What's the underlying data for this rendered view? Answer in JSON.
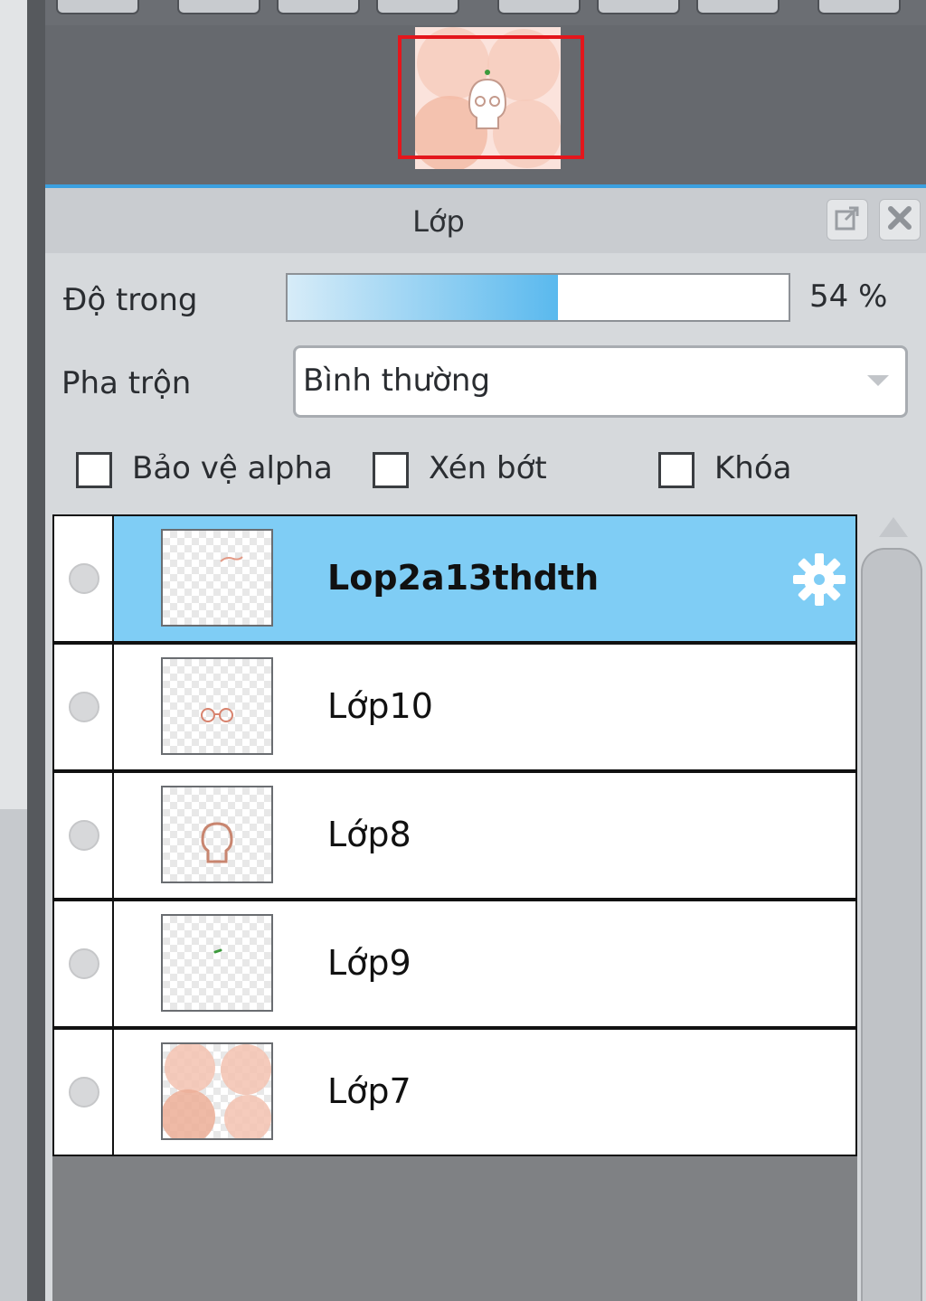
{
  "panel": {
    "title": "Lớp"
  },
  "opacity": {
    "label": "Độ trong",
    "percent": 54,
    "value_text": "54 %"
  },
  "blend": {
    "label": "Pha trộn",
    "value": "Bình thường"
  },
  "checkboxes": [
    {
      "label": "Bảo vệ alpha",
      "checked": false
    },
    {
      "label": "Xén bớt",
      "checked": false
    },
    {
      "label": "Khóa",
      "checked": false
    }
  ],
  "layers": [
    {
      "name": "Lop2a13thdth",
      "selected": true,
      "thumb": "doodle"
    },
    {
      "name": "Lớp10",
      "selected": false,
      "thumb": "glasses"
    },
    {
      "name": "Lớp8",
      "selected": false,
      "thumb": "head"
    },
    {
      "name": "Lớp9",
      "selected": false,
      "thumb": "dot"
    },
    {
      "name": "Lớp7",
      "selected": false,
      "thumb": "circles"
    }
  ],
  "colors": {
    "accent": "#3ba0e0",
    "selected_row": "#7fcdf5",
    "navigator_frame": "#e4161c"
  }
}
